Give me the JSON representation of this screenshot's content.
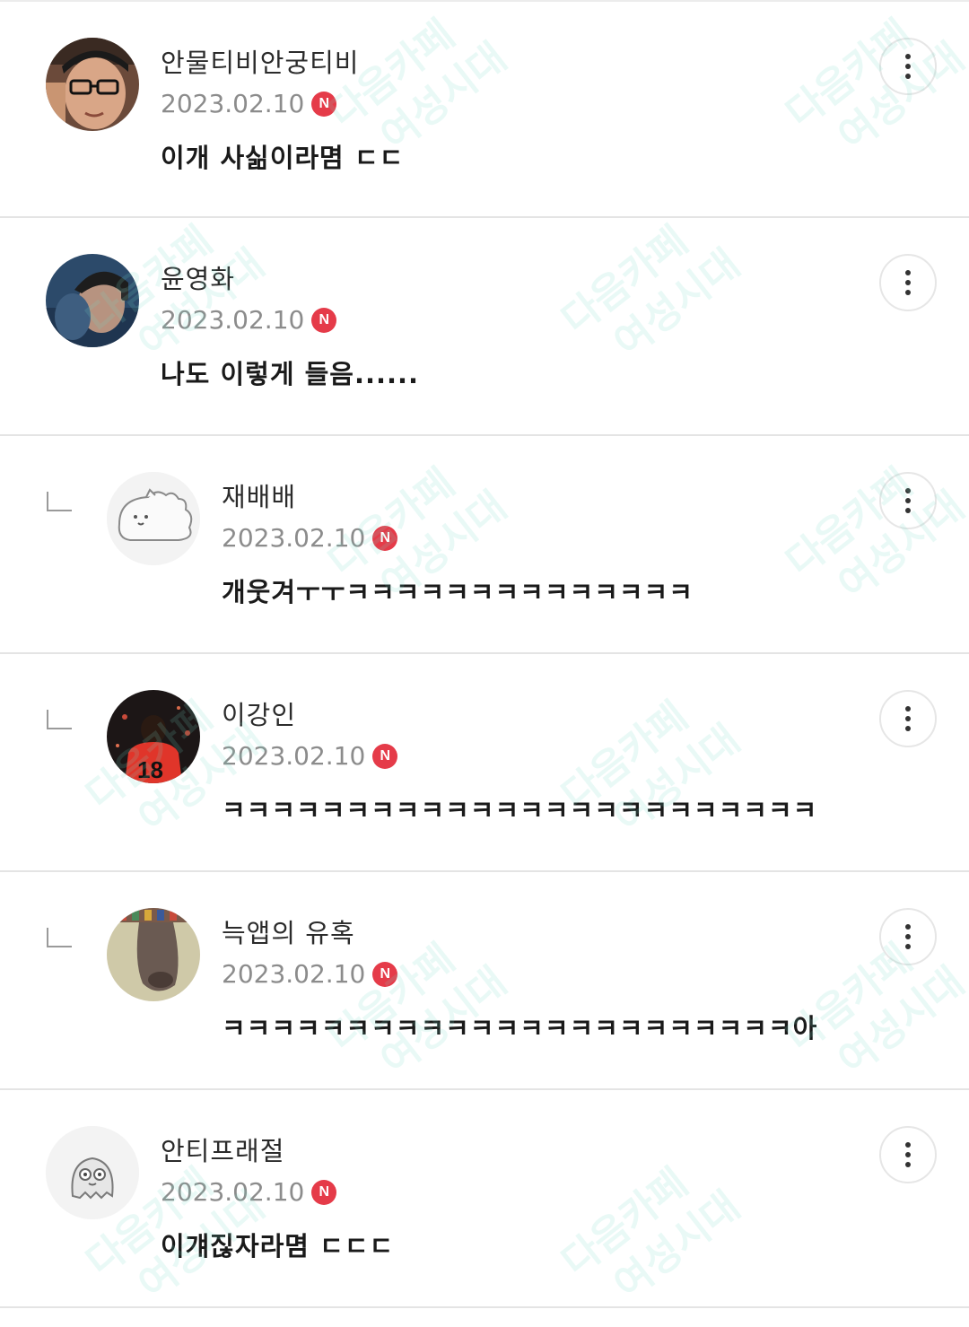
{
  "watermark": {
    "line1": "다음카페",
    "line2": "여성시대"
  },
  "comments": [
    {
      "author": "안물티비안궁티비",
      "date": "2023.02.10",
      "badge": "N",
      "text": "이개 사싦이라몀 ㄷㄷ",
      "reply": false,
      "avatar_icon": "user-photo-icon"
    },
    {
      "author": "윤영화",
      "date": "2023.02.10",
      "badge": "N",
      "text": "나도 이렇게 들음......",
      "reply": false,
      "avatar_icon": "user-photo-icon"
    },
    {
      "author": "재배배",
      "date": "2023.02.10",
      "badge": "N",
      "text": "개웃겨ㅜㅜㅋㅋㅋㅋㅋㅋㅋㅋㅋㅋㅋㅋㅋㅋ",
      "reply": true,
      "avatar_icon": "sheep-character-icon"
    },
    {
      "author": "이강인",
      "date": "2023.02.10",
      "badge": "N",
      "text": "ㅋㅋㅋㅋㅋㅋㅋㅋㅋㅋㅋㅋㅋㅋㅋㅋㅋㅋㅋㅋㅋㅋㅋㅋ",
      "reply": true,
      "avatar_icon": "soccer-player-photo-icon"
    },
    {
      "author": "늑앱의 유혹",
      "date": "2023.02.10",
      "badge": "N",
      "text": "ㅋㅋㅋㅋㅋㅋㅋㅋㅋㅋㅋㅋㅋㅋㅋㅋㅋㅋㅋㅋㅋㅋㅋ아",
      "reply": true,
      "avatar_icon": "animal-photo-icon"
    },
    {
      "author": "안티프래절",
      "date": "2023.02.10",
      "badge": "N",
      "text": "이걔짆자라몀 ㄷㄷㄷ",
      "reply": false,
      "avatar_icon": "ghost-character-icon"
    }
  ],
  "colors": {
    "badge": "#e53b49",
    "divider": "#e4e4e4",
    "date": "#8c8c8c",
    "author": "#2b2b2b"
  }
}
